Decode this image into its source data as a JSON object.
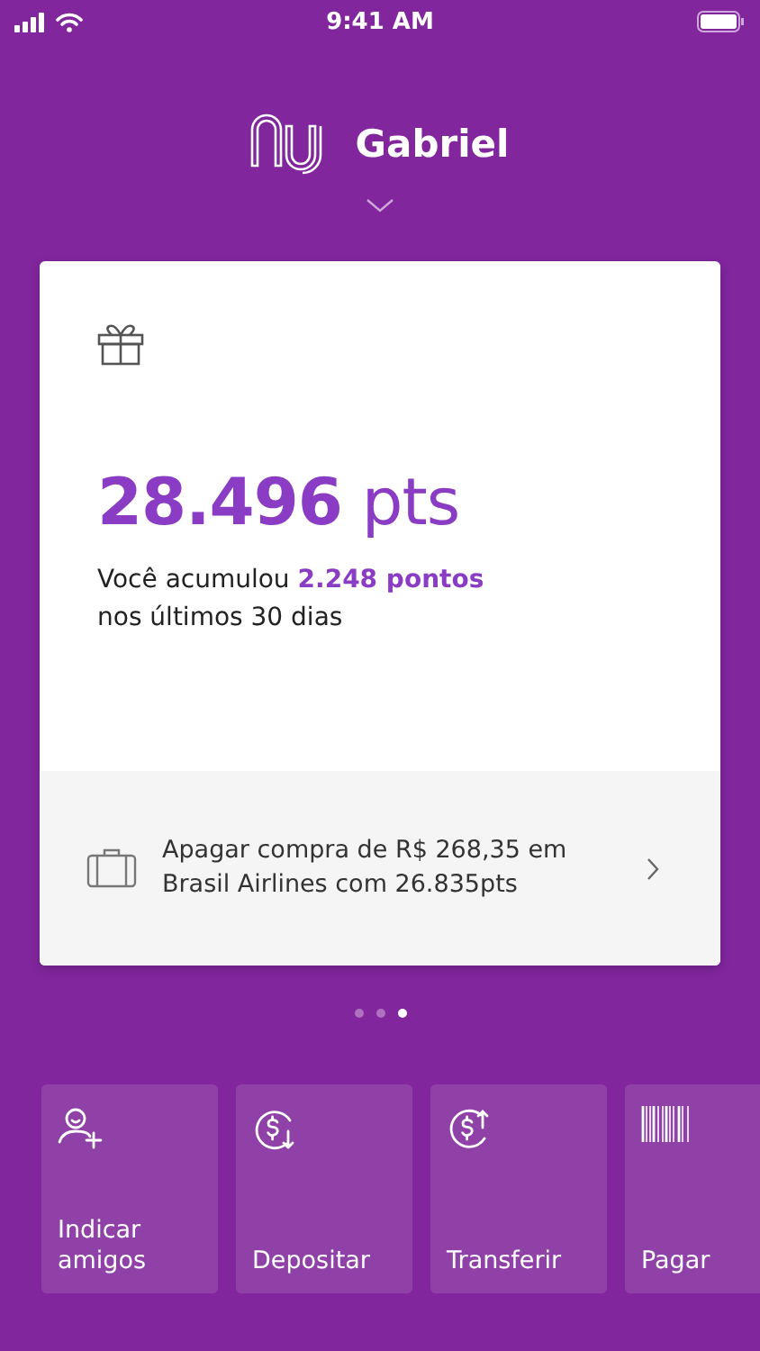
{
  "status_bar": {
    "time": "9:41 AM"
  },
  "header": {
    "name": "Gabriel"
  },
  "card": {
    "points": "**28.496** pts",
    "summary": "Você acumulou **2.248 pontos** nos últimos 30 dias",
    "offer": {
      "text": "Apagar compra de R$ 268,35 em Brasil Airlines com 26.835pts"
    }
  },
  "page_dots": [
    {
      "selected": false
    },
    {
      "selected": false
    },
    {
      "selected": true
    }
  ],
  "actions": [
    {
      "kind": "invite",
      "label": "Indicar amigos"
    },
    {
      "kind": "deposit",
      "label": "Depositar"
    },
    {
      "kind": "transfer",
      "label": "Transferir"
    },
    {
      "kind": "pay",
      "label": "Pagar"
    }
  ]
}
